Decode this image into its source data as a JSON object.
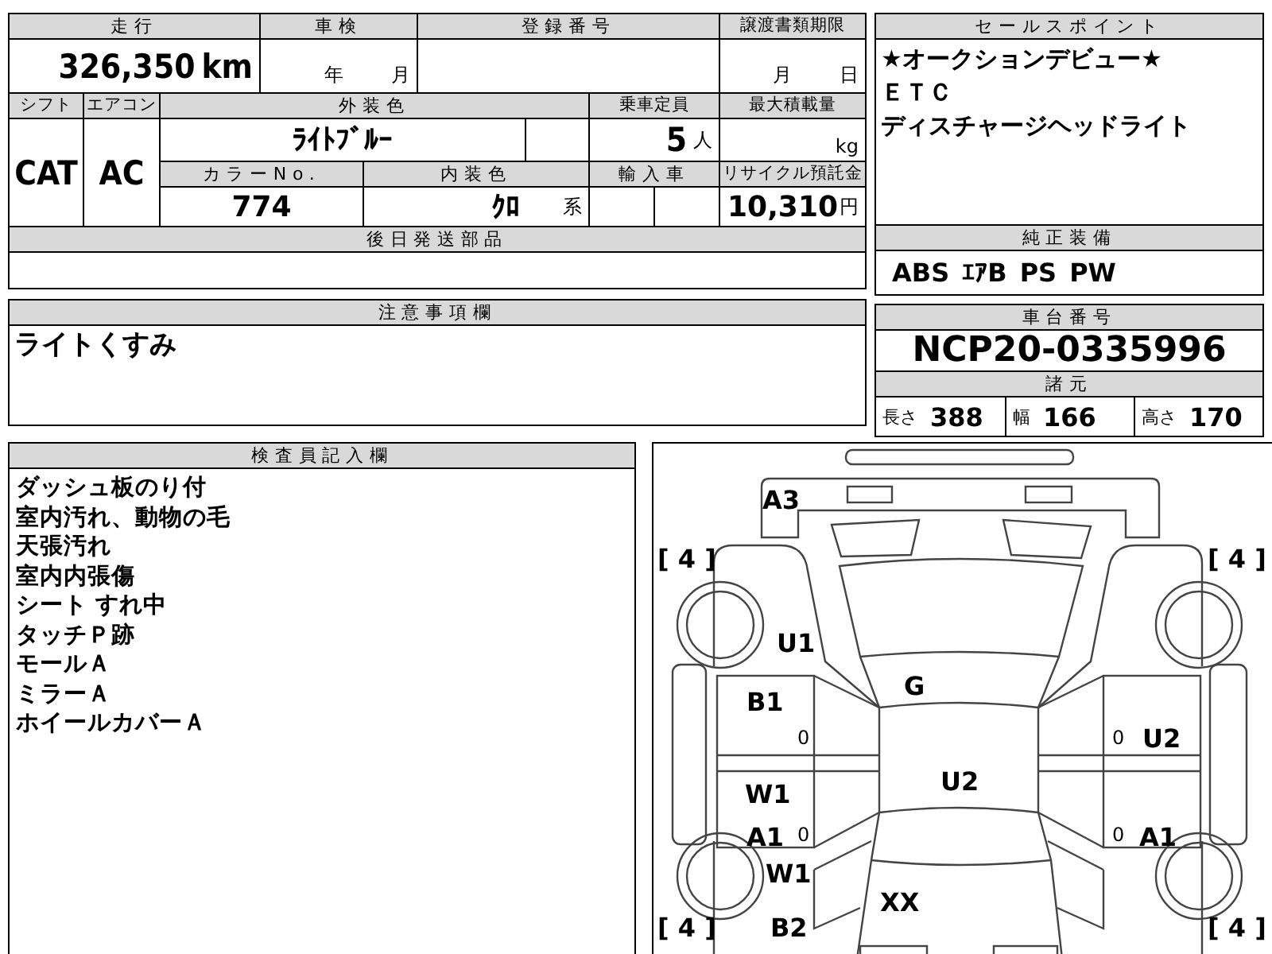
{
  "mileage": {
    "label": "走行",
    "value": "326,350",
    "unit": "km"
  },
  "inspection": {
    "label": "車検",
    "year_unit": "年",
    "month_unit": "月"
  },
  "registration_number": {
    "label": "登録番号"
  },
  "transfer_deadline": {
    "label": "譲渡書類期限",
    "month_unit": "月",
    "day_unit": "日"
  },
  "shift": {
    "label": "シフト",
    "value": "CAT"
  },
  "aircon": {
    "label": "エアコン",
    "value": "AC"
  },
  "exterior_color": {
    "label": "外装色",
    "value": "ﾗｲﾄﾌﾞﾙｰ"
  },
  "capacity": {
    "label": "乗車定員",
    "value": "5",
    "unit": "人"
  },
  "max_load": {
    "label": "最大積載量",
    "unit": "kg"
  },
  "color_number": {
    "label": "カラーNo.",
    "value": "774"
  },
  "interior_color": {
    "label": "内装色",
    "value": "ｸﾛ",
    "suffix": "系"
  },
  "imported": {
    "label": "輸入車"
  },
  "recycle_fee": {
    "label": "リサイクル預託金",
    "value": "10,310",
    "unit": "円"
  },
  "later_parts": {
    "label": "後日発送部品"
  },
  "sales_points": {
    "label": "セールスポイント",
    "lines": [
      "★オークションデビュー★",
      "ＥＴＣ",
      "ディスチャージヘッドライト"
    ]
  },
  "standard_equipment": {
    "label": "純正装備",
    "items": [
      "ABS",
      "ｴｱB",
      "PS",
      "PW"
    ]
  },
  "notes": {
    "label": "注意事項欄",
    "lines": [
      "ライトくすみ"
    ]
  },
  "chassis": {
    "label": "車台番号",
    "value": "NCP20-0335996"
  },
  "specs": {
    "label": "諸元",
    "items": [
      {
        "label": "長さ",
        "value": "388"
      },
      {
        "label": "幅",
        "value": "166"
      },
      {
        "label": "高さ",
        "value": "170"
      }
    ]
  },
  "inspector_notes": {
    "label": "検査員記入欄",
    "lines": [
      "ダッシュ板のり付",
      "室内汚れ、動物の毛",
      "天張汚れ",
      "室内内張傷",
      "シート すれ中",
      "タッチＰ跡",
      "モールＡ",
      "ミラーＡ",
      "ホイールカバーＡ"
    ]
  },
  "diagram": {
    "marks": [
      {
        "kind": "code",
        "text": "A3"
      },
      {
        "kind": "rank",
        "text": "[ 4 ]"
      },
      {
        "kind": "rank",
        "text": "[ 4 ]"
      },
      {
        "kind": "code",
        "text": "U1"
      },
      {
        "kind": "code",
        "text": "G"
      },
      {
        "kind": "code",
        "text": "B1"
      },
      {
        "kind": "small",
        "text": "0"
      },
      {
        "kind": "small",
        "text": "0"
      },
      {
        "kind": "code",
        "text": "U2"
      },
      {
        "kind": "code",
        "text": "W1"
      },
      {
        "kind": "code",
        "text": "U2"
      },
      {
        "kind": "code",
        "text": "A1"
      },
      {
        "kind": "small",
        "text": "0"
      },
      {
        "kind": "small",
        "text": "0"
      },
      {
        "kind": "code",
        "text": "A1"
      },
      {
        "kind": "code",
        "text": "W1"
      },
      {
        "kind": "code",
        "text": "XX"
      },
      {
        "kind": "rank",
        "text": "[ 4 ]"
      },
      {
        "kind": "code",
        "text": "B2"
      },
      {
        "kind": "rank",
        "text": "[ 4 ]"
      }
    ]
  }
}
